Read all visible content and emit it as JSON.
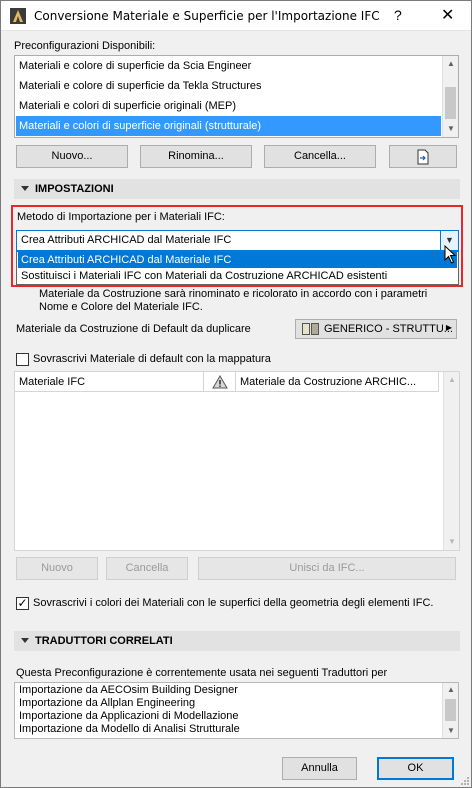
{
  "window": {
    "title": "Conversione Materiale e Superficie per l'Importazione IFC",
    "help": "?",
    "close": "✕"
  },
  "presets": {
    "label": "Preconfigurazioni Disponibili:",
    "items": [
      "Materiali e colore di superficie da Scia Engineer",
      "Materiali e colore di superficie da Tekla Structures",
      "Materiali e colori di superficie originali (MEP)",
      "Materiali e colori di superficie originali (strutturale)"
    ],
    "selected_index": 3,
    "buttons": {
      "new": "Nuovo...",
      "rename": "Rinomina...",
      "delete": "Cancella..."
    }
  },
  "settings": {
    "header": "IMPOSTAZIONI",
    "method_label": "Metodo di Importazione per i Materiali IFC:",
    "method_value": "Crea Attributi ARCHICAD dal Materiale IFC",
    "method_options": [
      "Crea Attributi ARCHICAD dal Materiale IFC",
      "Sostituisci i Materiali IFC con Materiali da Costruzione ARCHICAD esistenti"
    ],
    "description_line1": "Materiale da Costruzione sarà rinominato e ricolorato in accordo con i parametri",
    "description_line2": "Nome e Colore del Materiale IFC.",
    "default_material_label": "Materiale da Costruzione di Default da duplicare",
    "default_material_value": "GENERICO - STRUTTU...",
    "overwrite_default_label": "Sovrascrivi Materiale di default con la mappatura",
    "overwrite_default_checked": false,
    "table": {
      "col_ifc": "Materiale IFC",
      "col_archicad": "Materiale da Costruzione ARCHIC..."
    },
    "table_buttons": {
      "new": "Nuovo",
      "delete": "Cancella",
      "merge": "Unisci da IFC..."
    },
    "overwrite_colors_label": "Sovrascrivi i colori dei Materiali con le superfici della geometria degli elementi IFC.",
    "overwrite_colors_checked": true
  },
  "translators": {
    "header": "TRADUTTORI CORRELATI",
    "intro": "Questa Preconfigurazione è correntemente usata nei seguenti Traduttori per",
    "items": [
      "Importazione da AECOsim Building Designer",
      "Importazione da Allplan Engineering",
      "Importazione da Applicazioni di Modellazione",
      "Importazione da Modello di Analisi Strutturale"
    ]
  },
  "footer": {
    "cancel": "Annulla",
    "ok": "OK"
  },
  "colors": {
    "selection": "#3399ff",
    "highlight_border": "#e8262c",
    "focus": "#0078d7"
  }
}
